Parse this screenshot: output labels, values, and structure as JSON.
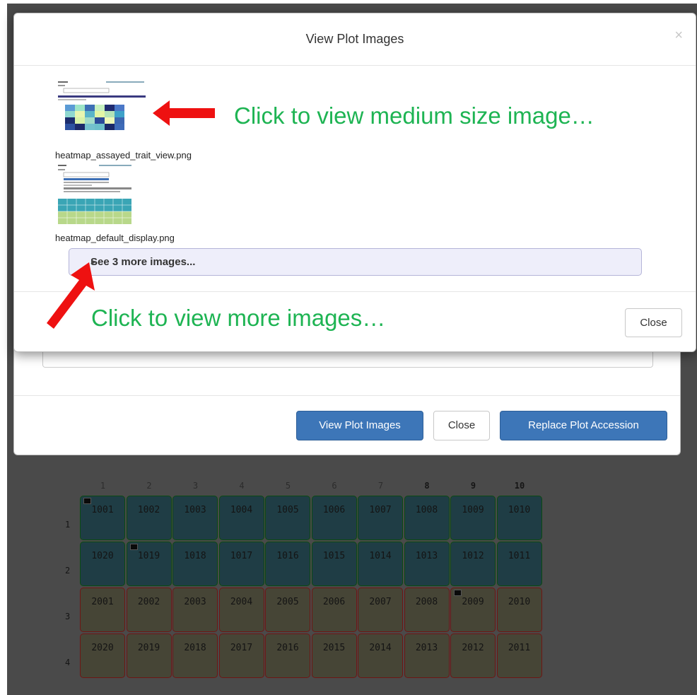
{
  "background_modal": {
    "buttons": [
      {
        "label": "View Plot Images"
      },
      {
        "label": "Close"
      },
      {
        "label": "Replace Plot Accession"
      }
    ]
  },
  "plot_images_modal": {
    "title": "View Plot Images",
    "close_x": "×",
    "images": [
      {
        "filename": "heatmap_assayed_trait_view.png"
      },
      {
        "filename": "heatmap_default_display.png"
      }
    ],
    "see_more_label": "See 3 more images...",
    "close_label": "Close"
  },
  "annotations": {
    "medium_size": "Click to view medium size image…",
    "more_images": "Click to view more images…",
    "arrow_color": "#ee1111",
    "text_color": "#1eb453"
  },
  "heatmap": {
    "columns": [
      "1",
      "2",
      "3",
      "4",
      "5",
      "6",
      "7",
      "8",
      "9",
      "10"
    ],
    "rows": [
      "1",
      "2",
      "3",
      "4"
    ],
    "cells": [
      [
        "1001",
        "1002",
        "1003",
        "1004",
        "1005",
        "1006",
        "1007",
        "1008",
        "1009",
        "1010"
      ],
      [
        "1020",
        "1019",
        "1018",
        "1017",
        "1016",
        "1015",
        "1014",
        "1013",
        "1012",
        "1011"
      ],
      [
        "2001",
        "2002",
        "2003",
        "2004",
        "2005",
        "2006",
        "2007",
        "2008",
        "2009",
        "2010"
      ],
      [
        "2020",
        "2019",
        "2018",
        "2017",
        "2016",
        "2015",
        "2014",
        "2013",
        "2012",
        "2011"
      ]
    ],
    "has_image": [
      "1001",
      "1019",
      "2009"
    ],
    "row_colors": [
      "teal",
      "teal",
      "olive",
      "olive"
    ]
  }
}
